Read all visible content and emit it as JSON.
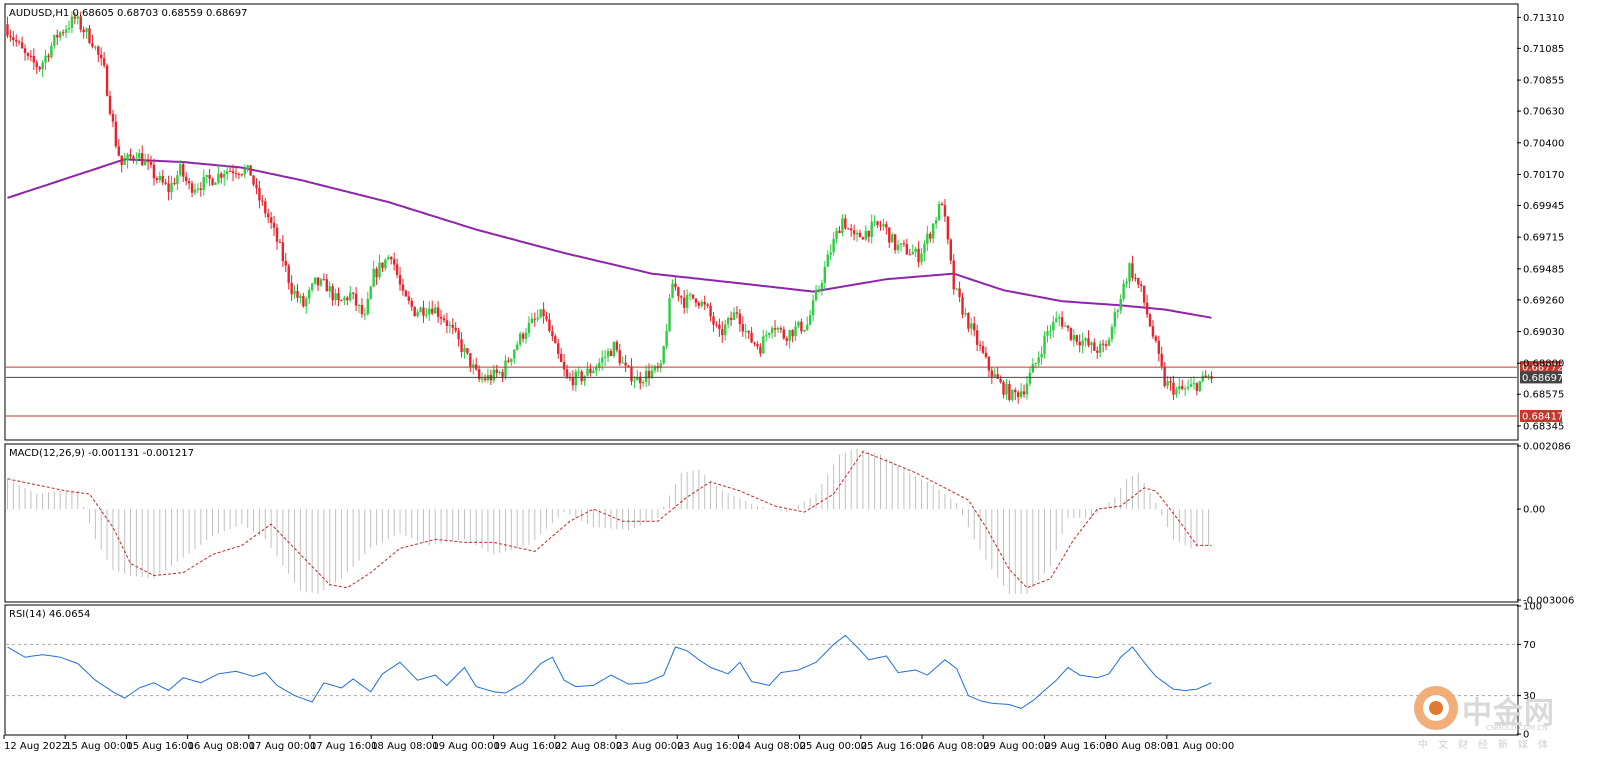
{
  "chart_data": [
    {
      "type": "candlestick",
      "symbol_header": "AUDUSD,H1  0.68605 0.68703 0.68559 0.68697",
      "ylim": [
        0.6825,
        0.714
      ],
      "y_ticks": [
        "0.71310",
        "0.71085",
        "0.70855",
        "0.70630",
        "0.70400",
        "0.70170",
        "0.69945",
        "0.69715",
        "0.69485",
        "0.69260",
        "0.69030",
        "0.68800",
        "0.68575",
        "0.68345"
      ],
      "x_labels": [
        "12 Aug 2022",
        "15 Aug 00:00",
        "15 Aug 16:00",
        "16 Aug 08:00",
        "17 Aug 00:00",
        "17 Aug 16:00",
        "18 Aug 08:00",
        "19 Aug 00:00",
        "19 Aug 16:00",
        "22 Aug 08:00",
        "23 Aug 00:00",
        "23 Aug 16:00",
        "24 Aug 08:00",
        "25 Aug 00:00",
        "25 Aug 16:00",
        "26 Aug 08:00",
        "29 Aug 00:00",
        "29 Aug 16:00",
        "30 Aug 08:00",
        "31 Aug 00:00"
      ],
      "price_path": [
        [
          0,
          0.7126
        ],
        [
          8,
          0.71
        ],
        [
          12,
          0.7095
        ],
        [
          18,
          0.7118
        ],
        [
          24,
          0.713
        ],
        [
          30,
          0.7114
        ],
        [
          34,
          0.7092
        ],
        [
          38,
          0.704
        ],
        [
          40,
          0.7024
        ],
        [
          45,
          0.7033
        ],
        [
          48,
          0.7025
        ],
        [
          52,
          0.7014
        ],
        [
          56,
          0.7006
        ],
        [
          60,
          0.702
        ],
        [
          63,
          0.7008
        ],
        [
          67,
          0.701
        ],
        [
          72,
          0.7015
        ],
        [
          75,
          0.702
        ],
        [
          80,
          0.7021
        ],
        [
          84,
          0.7018
        ],
        [
          86,
          0.7003
        ],
        [
          90,
          0.6986
        ],
        [
          94,
          0.6963
        ],
        [
          98,
          0.6934
        ],
        [
          102,
          0.6922
        ],
        [
          106,
          0.6938
        ],
        [
          110,
          0.6936
        ],
        [
          114,
          0.6923
        ],
        [
          118,
          0.693
        ],
        [
          123,
          0.6912
        ],
        [
          126,
          0.6944
        ],
        [
          132,
          0.696
        ],
        [
          136,
          0.6928
        ],
        [
          140,
          0.6918
        ],
        [
          146,
          0.6921
        ],
        [
          150,
          0.6913
        ],
        [
          154,
          0.6899
        ],
        [
          158,
          0.6884
        ],
        [
          162,
          0.6868
        ],
        [
          166,
          0.687
        ],
        [
          170,
          0.6874
        ],
        [
          174,
          0.6891
        ],
        [
          178,
          0.6905
        ],
        [
          184,
          0.6916
        ],
        [
          188,
          0.689
        ],
        [
          192,
          0.6868
        ],
        [
          197,
          0.687
        ],
        [
          202,
          0.6878
        ],
        [
          208,
          0.6892
        ],
        [
          212,
          0.6875
        ],
        [
          216,
          0.6868
        ],
        [
          220,
          0.6873
        ],
        [
          224,
          0.6875
        ],
        [
          228,
          0.6938
        ],
        [
          232,
          0.6925
        ],
        [
          236,
          0.6928
        ],
        [
          240,
          0.6918
        ],
        [
          244,
          0.69
        ],
        [
          250,
          0.6918
        ],
        [
          254,
          0.6898
        ],
        [
          258,
          0.6892
        ],
        [
          262,
          0.691
        ],
        [
          266,
          0.69
        ],
        [
          270,
          0.6905
        ],
        [
          274,
          0.6908
        ],
        [
          278,
          0.6935
        ],
        [
          282,
          0.6962
        ],
        [
          286,
          0.6985
        ],
        [
          290,
          0.697
        ],
        [
          296,
          0.6978
        ],
        [
          300,
          0.698
        ],
        [
          304,
          0.6965
        ],
        [
          308,
          0.6962
        ],
        [
          312,
          0.6958
        ],
        [
          316,
          0.6975
        ],
        [
          320,
          0.6998
        ],
        [
          324,
          0.6935
        ],
        [
          328,
          0.6914
        ],
        [
          332,
          0.6895
        ],
        [
          336,
          0.6876
        ],
        [
          340,
          0.6864
        ],
        [
          344,
          0.6856
        ],
        [
          348,
          0.6862
        ],
        [
          352,
          0.688
        ],
        [
          356,
          0.6903
        ],
        [
          360,
          0.6913
        ],
        [
          364,
          0.6901
        ],
        [
          368,
          0.6896
        ],
        [
          372,
          0.689
        ],
        [
          376,
          0.6891
        ],
        [
          380,
          0.6922
        ],
        [
          384,
          0.695
        ],
        [
          388,
          0.6932
        ],
        [
          392,
          0.69
        ],
        [
          396,
          0.6866
        ],
        [
          400,
          0.686
        ],
        [
          404,
          0.6861
        ],
        [
          408,
          0.6866
        ],
        [
          411,
          0.687
        ]
      ],
      "ma_line": [
        [
          0,
          0.7
        ],
        [
          40,
          0.7028
        ],
        [
          60,
          0.7026
        ],
        [
          80,
          0.7022
        ],
        [
          100,
          0.7013
        ],
        [
          130,
          0.6997
        ],
        [
          160,
          0.6977
        ],
        [
          190,
          0.696
        ],
        [
          220,
          0.6945
        ],
        [
          250,
          0.6938
        ],
        [
          275,
          0.6932
        ],
        [
          300,
          0.6941
        ],
        [
          323,
          0.6945
        ],
        [
          340,
          0.6933
        ],
        [
          360,
          0.6925
        ],
        [
          380,
          0.6922
        ],
        [
          395,
          0.6919
        ],
        [
          411,
          0.6913
        ]
      ],
      "horizontal_lines": [
        {
          "price": 0.68772,
          "label": "0.68772",
          "color": "#c0392b"
        },
        {
          "price": 0.68697,
          "label": "0.68697",
          "color": "#444444"
        },
        {
          "price": 0.68417,
          "label": "0.68417",
          "color": "#c0392b"
        }
      ],
      "colors": {
        "up": "#2ecc40",
        "down": "#e8232c",
        "ma": "#8e24aa",
        "hline": "#c0392b"
      }
    },
    {
      "type": "macd",
      "title": "MACD(12,26,9) -0.001131 -0.001217",
      "ylim": [
        -0.003006,
        0.002086
      ],
      "y_ticks": [
        "0.002086",
        "0.00",
        "-0.003006"
      ],
      "histogram": [
        [
          0,
          0.001
        ],
        [
          10,
          0.0005
        ],
        [
          18,
          0.0006
        ],
        [
          24,
          0.0006
        ],
        [
          30,
          -0.001
        ],
        [
          36,
          -0.002
        ],
        [
          42,
          -0.0022
        ],
        [
          50,
          -0.0023
        ],
        [
          60,
          -0.0016
        ],
        [
          70,
          -0.0009
        ],
        [
          80,
          -0.0005
        ],
        [
          88,
          -0.001
        ],
        [
          100,
          -0.0027
        ],
        [
          106,
          -0.0028
        ],
        [
          114,
          -0.0023
        ],
        [
          124,
          -0.0013
        ],
        [
          134,
          -0.0008
        ],
        [
          144,
          -0.0012
        ],
        [
          156,
          -0.001
        ],
        [
          166,
          -0.0015
        ],
        [
          178,
          -0.0012
        ],
        [
          190,
          -0.0001
        ],
        [
          200,
          -0.0006
        ],
        [
          212,
          -0.0007
        ],
        [
          222,
          -0.0003
        ],
        [
          230,
          0.0012
        ],
        [
          236,
          0.0013
        ],
        [
          244,
          0.0006
        ],
        [
          256,
          0.0001
        ],
        [
          266,
          -0.0001
        ],
        [
          276,
          0.0005
        ],
        [
          284,
          0.0018
        ],
        [
          290,
          0.002
        ],
        [
          298,
          0.0018
        ],
        [
          308,
          0.0012
        ],
        [
          316,
          0.0008
        ],
        [
          324,
          0.0002
        ],
        [
          330,
          -0.001
        ],
        [
          336,
          -0.002
        ],
        [
          342,
          -0.0028
        ],
        [
          348,
          -0.0028
        ],
        [
          356,
          -0.0019
        ],
        [
          362,
          -0.0003
        ],
        [
          370,
          -0.0003
        ],
        [
          378,
          0.0004
        ],
        [
          382,
          0.001
        ],
        [
          386,
          0.0012
        ],
        [
          392,
          0.0002
        ],
        [
          398,
          -0.001
        ],
        [
          404,
          -0.0013
        ],
        [
          411,
          -0.0012
        ]
      ],
      "signal": [
        [
          0,
          0.001
        ],
        [
          10,
          0.0008
        ],
        [
          20,
          0.0006
        ],
        [
          28,
          0.0005
        ],
        [
          36,
          -0.0006
        ],
        [
          42,
          -0.0018
        ],
        [
          50,
          -0.0022
        ],
        [
          60,
          -0.0021
        ],
        [
          70,
          -0.0015
        ],
        [
          80,
          -0.0012
        ],
        [
          90,
          -0.0005
        ],
        [
          100,
          -0.0015
        ],
        [
          110,
          -0.0025
        ],
        [
          116,
          -0.0026
        ],
        [
          124,
          -0.0021
        ],
        [
          134,
          -0.0013
        ],
        [
          146,
          -0.001
        ],
        [
          156,
          -0.0011
        ],
        [
          166,
          -0.0011
        ],
        [
          180,
          -0.0014
        ],
        [
          192,
          -0.0004
        ],
        [
          200,
          0.0
        ],
        [
          210,
          -0.0004
        ],
        [
          222,
          -0.0004
        ],
        [
          232,
          0.0004
        ],
        [
          240,
          0.0009
        ],
        [
          250,
          0.0006
        ],
        [
          262,
          0.0001
        ],
        [
          272,
          -0.0001
        ],
        [
          282,
          0.0005
        ],
        [
          292,
          0.0019
        ],
        [
          300,
          0.0016
        ],
        [
          310,
          0.0012
        ],
        [
          320,
          0.0007
        ],
        [
          328,
          0.0003
        ],
        [
          334,
          -0.0006
        ],
        [
          342,
          -0.002
        ],
        [
          348,
          -0.0026
        ],
        [
          356,
          -0.0023
        ],
        [
          364,
          -0.001
        ],
        [
          372,
          0.0
        ],
        [
          380,
          0.0001
        ],
        [
          388,
          0.0007
        ],
        [
          392,
          0.0006
        ],
        [
          400,
          -0.0004
        ],
        [
          406,
          -0.0012
        ],
        [
          411,
          -0.0012
        ]
      ],
      "colors": {
        "hist": "#c0c0c0",
        "signal": "#c62828"
      }
    },
    {
      "type": "line",
      "title": "RSI(14) 46.0654",
      "ylim": [
        0,
        100
      ],
      "y_ticks": [
        "100",
        "70",
        "30",
        "0"
      ],
      "levels": [
        70,
        30
      ],
      "values": [
        [
          0,
          68
        ],
        [
          6,
          60
        ],
        [
          12,
          62
        ],
        [
          18,
          60
        ],
        [
          24,
          55
        ],
        [
          30,
          42
        ],
        [
          36,
          33
        ],
        [
          40,
          28
        ],
        [
          45,
          36
        ],
        [
          50,
          40
        ],
        [
          55,
          34
        ],
        [
          60,
          44
        ],
        [
          66,
          40
        ],
        [
          72,
          47
        ],
        [
          78,
          49
        ],
        [
          84,
          45
        ],
        [
          88,
          48
        ],
        [
          92,
          38
        ],
        [
          98,
          30
        ],
        [
          104,
          25
        ],
        [
          108,
          40
        ],
        [
          114,
          36
        ],
        [
          118,
          43
        ],
        [
          124,
          33
        ],
        [
          128,
          47
        ],
        [
          134,
          56
        ],
        [
          140,
          42
        ],
        [
          146,
          46
        ],
        [
          150,
          38
        ],
        [
          156,
          52
        ],
        [
          160,
          37
        ],
        [
          166,
          33
        ],
        [
          170,
          32
        ],
        [
          176,
          40
        ],
        [
          182,
          55
        ],
        [
          186,
          60
        ],
        [
          190,
          42
        ],
        [
          194,
          37
        ],
        [
          200,
          38
        ],
        [
          206,
          46
        ],
        [
          212,
          39
        ],
        [
          218,
          40
        ],
        [
          224,
          46
        ],
        [
          228,
          68
        ],
        [
          232,
          65
        ],
        [
          236,
          58
        ],
        [
          240,
          52
        ],
        [
          246,
          47
        ],
        [
          250,
          56
        ],
        [
          254,
          41
        ],
        [
          260,
          38
        ],
        [
          264,
          48
        ],
        [
          270,
          50
        ],
        [
          276,
          56
        ],
        [
          282,
          70
        ],
        [
          286,
          77
        ],
        [
          290,
          68
        ],
        [
          294,
          58
        ],
        [
          300,
          61
        ],
        [
          304,
          48
        ],
        [
          310,
          50
        ],
        [
          314,
          46
        ],
        [
          320,
          58
        ],
        [
          324,
          51
        ],
        [
          328,
          30
        ],
        [
          332,
          26
        ],
        [
          336,
          24
        ],
        [
          342,
          23
        ],
        [
          346,
          20
        ],
        [
          350,
          26
        ],
        [
          354,
          34
        ],
        [
          358,
          42
        ],
        [
          362,
          52
        ],
        [
          366,
          46
        ],
        [
          372,
          44
        ],
        [
          376,
          47
        ],
        [
          380,
          60
        ],
        [
          384,
          68
        ],
        [
          388,
          56
        ],
        [
          392,
          45
        ],
        [
          398,
          35
        ],
        [
          402,
          34
        ],
        [
          406,
          35
        ],
        [
          411,
          40
        ]
      ],
      "colors": {
        "line": "#1e6fd9",
        "level": "#aaaaaa"
      }
    }
  ],
  "watermark": {
    "name": "中金网",
    "site": "CNGOLD.COM.CN",
    "sub": "中文财经新媒体"
  }
}
